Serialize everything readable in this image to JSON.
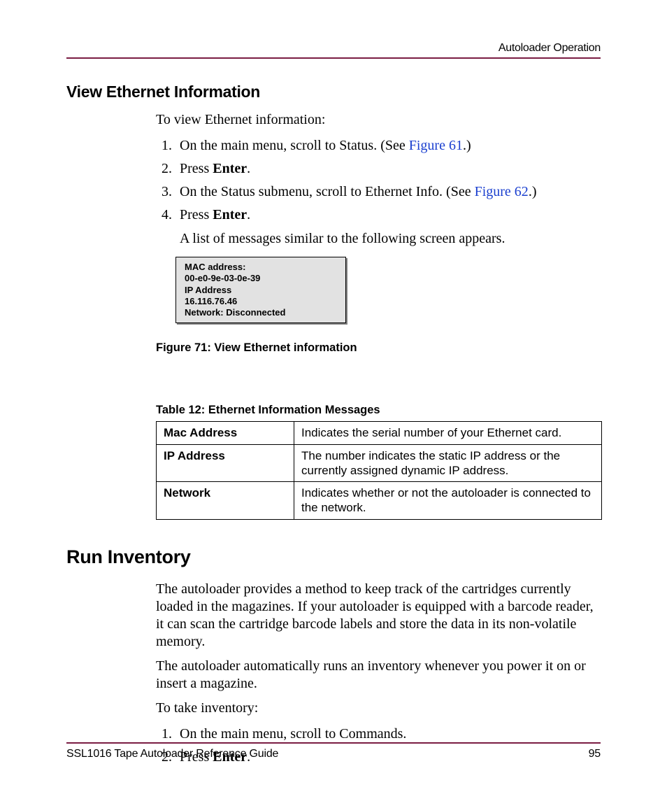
{
  "header": {
    "running": "Autoloader Operation"
  },
  "section_ethernet": {
    "title": "View Ethernet Information",
    "intro": "To view Ethernet information:",
    "steps": {
      "s1_a": "On the main menu, scroll to Status. (See ",
      "s1_link": "Figure 61",
      "s1_b": ".)",
      "s2_a": "Press ",
      "s2_bold": "Enter",
      "s2_b": ".",
      "s3_a": "On the Status submenu, scroll to Ethernet Info. (See ",
      "s3_link": "Figure 62",
      "s3_b": ".)",
      "s4_a": "Press ",
      "s4_bold": "Enter",
      "s4_b": "."
    },
    "after_steps": "A list of messages similar to the following screen appears.",
    "lcd": {
      "l1": "MAC address:",
      "l2": "00-e0-9e-03-0e-39",
      "l3": "IP Address",
      "l4": "16.116.76.46",
      "l5": "Network: Disconnected"
    },
    "figure_caption": "Figure 71:  View Ethernet information",
    "table_caption": "Table 12:  Ethernet Information Messages",
    "table": {
      "r1": {
        "k": "Mac Address",
        "v": "Indicates the serial number of your Ethernet card."
      },
      "r2": {
        "k": "IP Address",
        "v": "The number indicates the static IP address or the currently assigned dynamic IP address."
      },
      "r3": {
        "k": "Network",
        "v": "Indicates whether or not the autoloader is connected to the network."
      }
    }
  },
  "section_inventory": {
    "title": "Run Inventory",
    "p1": "The autoloader provides a method to keep track of the cartridges currently loaded in the magazines. If your autoloader is equipped with a barcode reader, it can scan the cartridge barcode labels and store the data in its non-volatile memory.",
    "p2": "The autoloader automatically runs an inventory whenever you power it on or insert a magazine.",
    "p3": "To take inventory:",
    "steps": {
      "s1": "On the main menu, scroll to Commands.",
      "s2_a": "Press ",
      "s2_bold": "Enter",
      "s2_b": "."
    }
  },
  "footer": {
    "title": "SSL1016 Tape Autoloader Reference Guide",
    "page": "95"
  }
}
